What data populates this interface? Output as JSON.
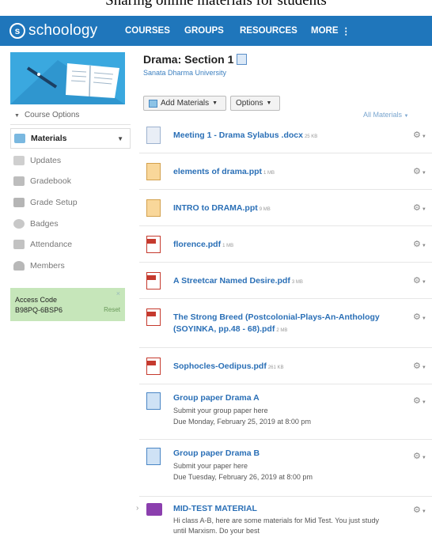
{
  "caption": "Sharing online materials for students",
  "brand": {
    "logo_letter": "s",
    "name": "schoology"
  },
  "nav": {
    "courses": "COURSES",
    "groups": "GROUPS",
    "resources": "RESOURCES",
    "more": "MORE",
    "more_dots": "⋮"
  },
  "sidebar": {
    "course_options": "Course Options",
    "items": [
      {
        "label": "Materials",
        "icon": "materials-icon"
      },
      {
        "label": "Updates",
        "icon": "updates-icon"
      },
      {
        "label": "Gradebook",
        "icon": "gradebook-icon"
      },
      {
        "label": "Grade Setup",
        "icon": "grade-setup-icon"
      },
      {
        "label": "Badges",
        "icon": "badges-icon"
      },
      {
        "label": "Attendance",
        "icon": "attendance-icon"
      },
      {
        "label": "Members",
        "icon": "members-icon"
      }
    ],
    "access": {
      "label": "Access Code",
      "code": "B98PQ-6BSP6",
      "reset": "Reset",
      "close": "×"
    }
  },
  "main": {
    "title": "Drama: Section 1",
    "university": "Sanata Dharma University",
    "add_materials": "Add Materials",
    "options": "Options",
    "all_materials": "All Materials",
    "materials": [
      {
        "type": "doc",
        "name": "Meeting 1 - Drama Sylabus .docx",
        "size": "25 KB"
      },
      {
        "type": "ppt",
        "name": "elements of drama.ppt",
        "size": "1 MB"
      },
      {
        "type": "ppt",
        "name": "INTRO to DRAMA.ppt",
        "size": "9 MB"
      },
      {
        "type": "pdf",
        "name": "florence.pdf",
        "size": "1 MB"
      },
      {
        "type": "pdf",
        "name": "A Streetcar Named Desire.pdf",
        "size": "3 MB"
      },
      {
        "type": "pdf",
        "name_line1": "The Strong Breed (Postcolonial-Plays-An-Anthology",
        "name_line2": "(SOYINKA, pp.48 - 68).pdf",
        "size": "2 MB"
      },
      {
        "type": "pdf",
        "name": "Sophocles-Oedipus.pdf",
        "size": "261 KB"
      },
      {
        "type": "assignment",
        "name": "Group paper Drama A",
        "desc": "Submit your group paper here",
        "due": "Due Monday, February 25, 2019 at 8:00 pm"
      },
      {
        "type": "assignment",
        "name": "Group paper Drama B",
        "desc": "Submit your paper here",
        "due": "Due Tuesday, February 26, 2019 at 8:00 pm"
      },
      {
        "type": "folder",
        "name": "MID-TEST MATERIAL",
        "desc_line1": "Hi class A-B, here are some materials for Mid Test. You just study",
        "desc_line2": "until Marxism. Do your best"
      }
    ]
  },
  "colors": {
    "topbar": "#1f76bb",
    "link": "#2a6fb6",
    "access_bg": "#c6e6ba",
    "folder": "#8b3fae",
    "pdf": "#c53a2e"
  }
}
